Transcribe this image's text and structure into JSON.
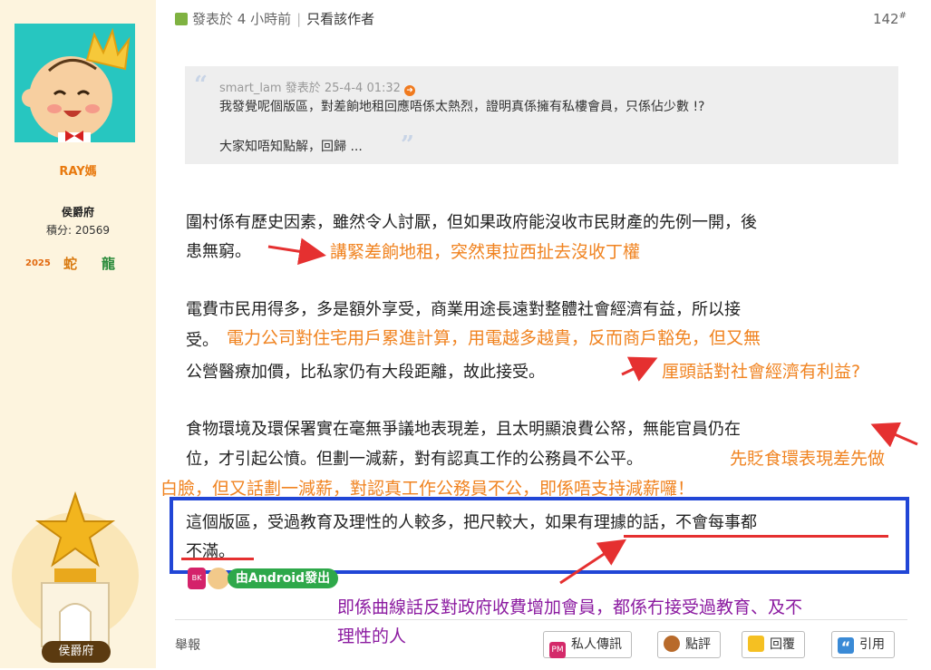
{
  "user": {
    "name": "RAY媽",
    "rank": "侯爵府",
    "score": "積分: 20569",
    "badges": [
      "2025",
      "蛇",
      "龍"
    ],
    "trophy_label": "侯爵府"
  },
  "post": {
    "posted": "發表於 4 小時前",
    "only_author": "只看該作者",
    "floor": "142",
    "floor_mark": "#"
  },
  "quote": {
    "meta": "smart_lam 發表於 25-4-4 01:32",
    "line1": "我發覺呢個版區，對差餉地租回應唔係太熱烈，證明真係擁有私樓會員，只係佔少數 !?",
    "line2": "大家知唔知點解，回歸 ..."
  },
  "body": {
    "p1_l1": "圍村係有歷史因素，雖然令人討厭，但如果政府能沒收市民財產的先例一開，後",
    "p1_l2": "患無窮。",
    "p2_l1": "電費市民用得多，多是額外享受，商業用途長遠對整體社會經濟有益，所以接",
    "p2_l2": "受。",
    "p2_l3": "公營醫療加價，比私家仍有大段距離，故此接受。",
    "p3_l1": "食物環境及環保署實在毫無爭議地表現差，且太明顯浪費公帑，無能官員仍在",
    "p3_l2": "位，才引起公憤。但劃一減薪，對有認真工作的公務員不公平。",
    "p4_l1": "這個版區，受過教育及理性的人較多，把尺較大，如果有理據的話，不會每事都",
    "p4_l2": "不滿。"
  },
  "annotations": {
    "a1": "講緊差餉地租，突然東拉西扯去沒收丁權",
    "a2a": "電力公司對住宅用戶累進計算，用電越多越貴，反而商戶豁免，但又無",
    "a2b": "厘頭話對社會經濟有利益?",
    "a3a": "先貶食環表現差先做",
    "a3b": "白臉，但又話劃一減薪，對認真工作公務員不公，即係唔支持減薪囉！",
    "a4a": "即係曲線話反對政府收費增加會員，都係冇接受過教育、及不",
    "a4b": "理性的人"
  },
  "android_label": "由Android發出",
  "footer": {
    "report": "舉報",
    "pm": "私人傳訊",
    "rate": "點評",
    "reply": "回覆",
    "cite": "引用"
  },
  "colors": {
    "annotation_orange": "#f08320",
    "annotation_purple": "#8b1aa0",
    "arrow_red": "#e53030",
    "box_blue": "#2146d6"
  }
}
